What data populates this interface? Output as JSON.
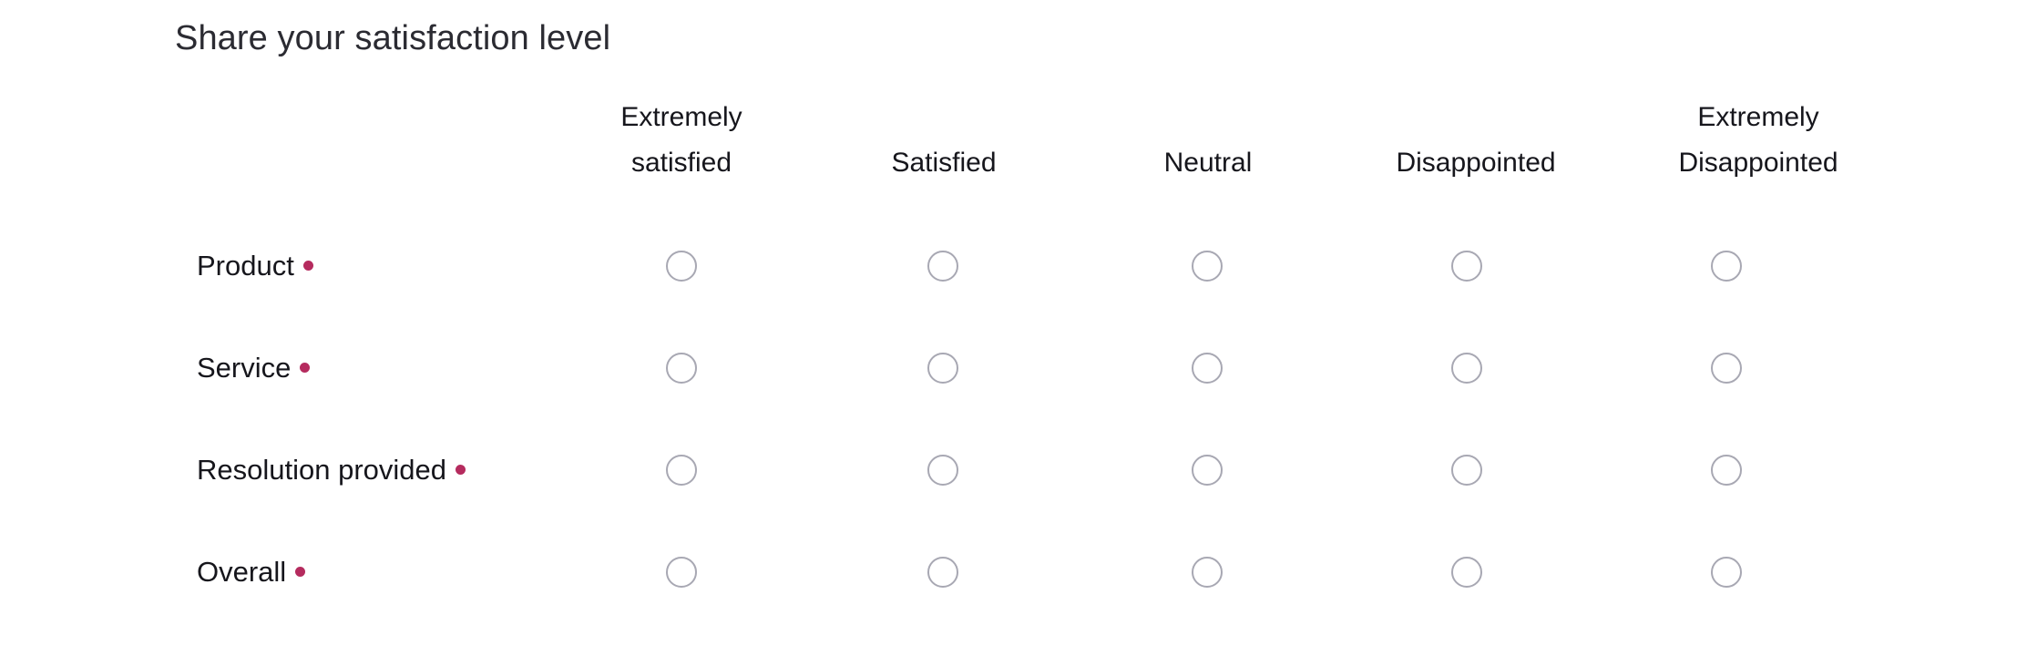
{
  "question": {
    "title": "Share your satisfaction level",
    "required_marker": "•",
    "required_color": "#b52b5e"
  },
  "matrix": {
    "columns": [
      {
        "label": "Extremely satisfied",
        "lines": [
          "Extremely",
          "satisfied"
        ]
      },
      {
        "label": "Satisfied",
        "lines": [
          "Satisfied"
        ]
      },
      {
        "label": "Neutral",
        "lines": [
          "Neutral"
        ]
      },
      {
        "label": "Disappointed",
        "lines": [
          "Disappointed"
        ]
      },
      {
        "label": "Extremely Disappointed",
        "lines": [
          "Extremely",
          "Disappointed"
        ]
      }
    ],
    "rows": [
      {
        "label": "Product",
        "required": true,
        "selected": null
      },
      {
        "label": "Service",
        "required": true,
        "selected": null
      },
      {
        "label": "Resolution provided",
        "required": true,
        "selected": null
      },
      {
        "label": "Overall",
        "required": true,
        "selected": null
      }
    ]
  },
  "theme": {
    "background": "#ffffff",
    "title_color": "#2b2b32",
    "text_color": "#16161c",
    "radio_border": "#a8a8b3",
    "accent": "#b52b5e"
  }
}
